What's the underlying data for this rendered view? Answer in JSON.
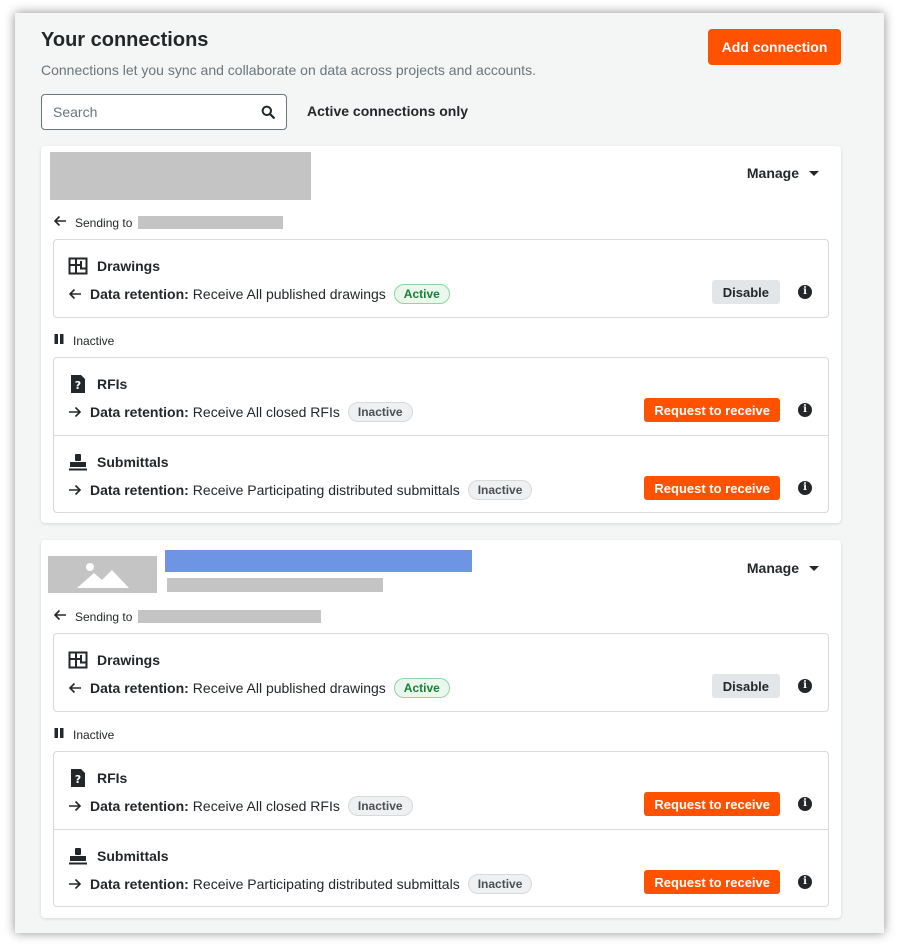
{
  "header": {
    "title": "Your connections",
    "subtitle": "Connections let you sync and collaborate on data across projects and accounts.",
    "add_button": "Add connection"
  },
  "search": {
    "placeholder": "Search",
    "value": ""
  },
  "filter": {
    "active_only_label": "Active connections only"
  },
  "colors": {
    "accent": "#ff5200",
    "active_green": "#1a7f37",
    "link_blue_placeholder": "#6e95e3"
  },
  "connections": [
    {
      "manage_label": "Manage",
      "sending_label": "Sending to",
      "active_tool": {
        "name": "Drawings",
        "icon": "floor-plan-icon",
        "retention_label": "Data retention:",
        "retention_value": "Receive All published drawings",
        "status": "Active",
        "action": "Disable"
      },
      "inactive_label": "Inactive",
      "inactive_tools": [
        {
          "name": "RFIs",
          "icon": "question-document-icon",
          "retention_label": "Data retention:",
          "retention_value": "Receive All closed RFIs",
          "status": "Inactive",
          "action": "Request to receive"
        },
        {
          "name": "Submittals",
          "icon": "stamp-icon",
          "retention_label": "Data retention:",
          "retention_value": "Receive Participating distributed submittals",
          "status": "Inactive",
          "action": "Request to receive"
        }
      ]
    },
    {
      "manage_label": "Manage",
      "sending_label": "Sending to",
      "active_tool": {
        "name": "Drawings",
        "icon": "floor-plan-icon",
        "retention_label": "Data retention:",
        "retention_value": "Receive All published drawings",
        "status": "Active",
        "action": "Disable"
      },
      "inactive_label": "Inactive",
      "inactive_tools": [
        {
          "name": "RFIs",
          "icon": "question-document-icon",
          "retention_label": "Data retention:",
          "retention_value": "Receive All closed RFIs",
          "status": "Inactive",
          "action": "Request to receive"
        },
        {
          "name": "Submittals",
          "icon": "stamp-icon",
          "retention_label": "Data retention:",
          "retention_value": "Receive Participating distributed submittals",
          "status": "Inactive",
          "action": "Request to receive"
        }
      ]
    }
  ]
}
